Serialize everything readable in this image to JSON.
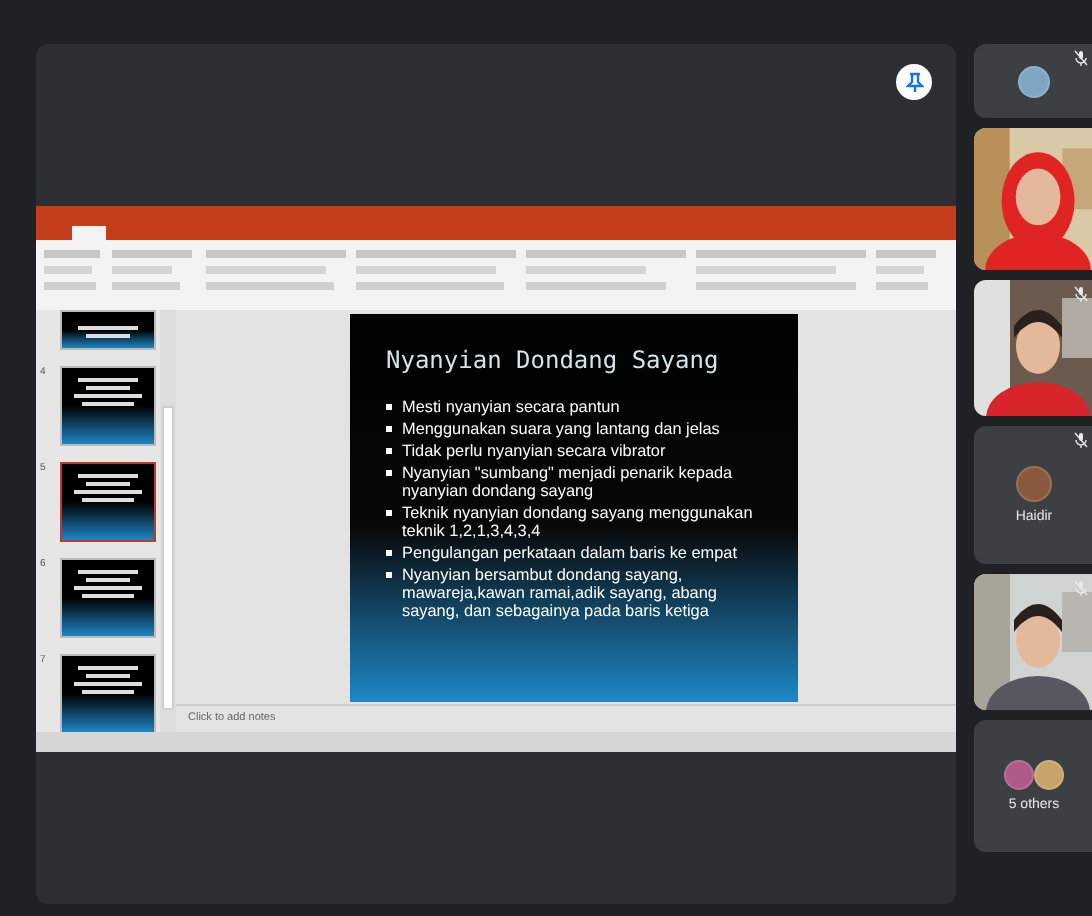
{
  "presentation": {
    "thumbnails": [
      {
        "selected": false
      },
      {
        "number": "4",
        "selected": false
      },
      {
        "number": "5",
        "selected": true
      },
      {
        "number": "6",
        "selected": false
      },
      {
        "number": "7",
        "selected": false
      }
    ],
    "slide": {
      "title": "Nyanyian Dondang Sayang",
      "bullets": [
        "Mesti nyanyian secara pantun",
        "Menggunakan suara yang lantang dan jelas",
        "Tidak perlu nyanyian secara vibrator",
        "Nyanyian \"sumbang\" menjadi penarik kepada nyanyian dondang sayang",
        "Teknik nyanyian dondang sayang menggunakan teknik 1,2,1,3,4,3,4",
        "Pengulangan perkataan dalam baris ke empat",
        "Nyanyian bersambut dondang sayang, mawareja,kawan ramai,adik sayang, abang sayang, dan sebagainya pada baris ketiga"
      ]
    },
    "notes_placeholder": "Click to add notes"
  },
  "participants": [
    {
      "kind": "avatar",
      "muted": true
    },
    {
      "kind": "video",
      "muted": false
    },
    {
      "kind": "video",
      "muted": true
    },
    {
      "kind": "avatar",
      "name": "Haidir",
      "muted": true
    },
    {
      "kind": "video",
      "muted": true
    },
    {
      "kind": "group",
      "name": "5 others"
    }
  ]
}
